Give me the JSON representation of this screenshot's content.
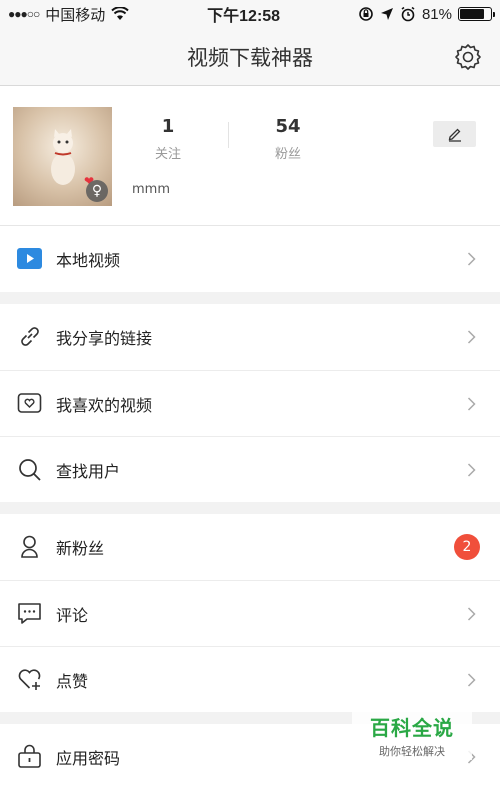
{
  "status_bar": {
    "carrier": "中国移动",
    "time": "下午12:58",
    "battery": "81%",
    "battery_level": 0.81
  },
  "nav": {
    "title": "视频下载神器",
    "settings_icon": "gear-icon"
  },
  "profile": {
    "following": {
      "count": "1",
      "label": "关注"
    },
    "fans": {
      "count": "54",
      "label": "粉丝"
    },
    "username": "mmm",
    "gender": "female",
    "edit_icon": "pencil-icon"
  },
  "menu": {
    "local_video": "本地视频",
    "shared_links": "我分享的链接",
    "liked_videos": "我喜欢的视频",
    "find_users": "查找用户",
    "new_fans": "新粉丝",
    "new_fans_badge": "2",
    "comments": "评论",
    "likes": "点赞",
    "app_password": "应用密码"
  },
  "colors": {
    "accent_blue": "#2d8ae0",
    "badge_red": "#f04f3b"
  },
  "watermark": {
    "title": "百科全说",
    "subtitle": "助你轻松解决"
  }
}
